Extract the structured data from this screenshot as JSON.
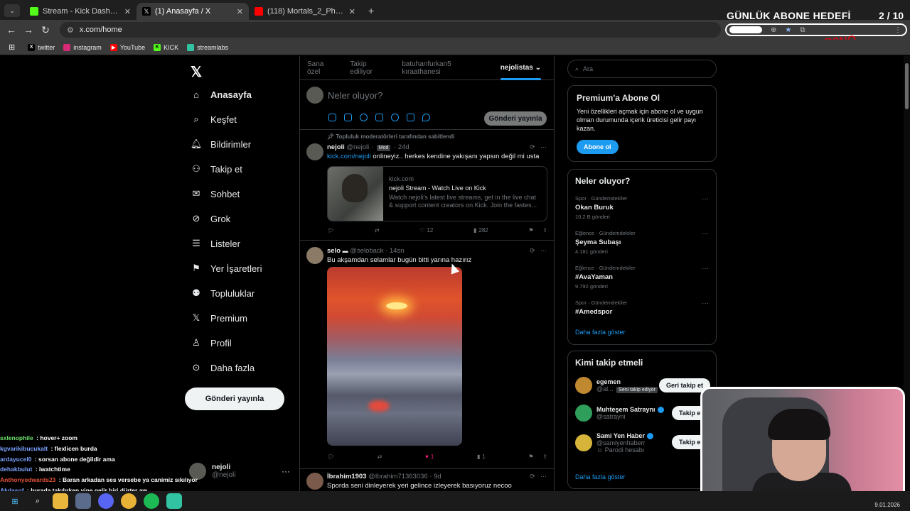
{
  "browser": {
    "tabs": [
      {
        "title": "Stream - Kick Dashboard",
        "favicon_color": "#53fc18",
        "active": false
      },
      {
        "title": "(1) Anasayfa / X",
        "favicon_color": "#000000",
        "active": true
      },
      {
        "title": "(118) Mortals_2_Phut_Hon_Funk",
        "favicon_color": "#ff0000",
        "active": false
      }
    ],
    "url": "x.com/home",
    "bookmarks": [
      "twitter",
      "instagram",
      "YouTube",
      "KICK",
      "streamlabs"
    ]
  },
  "overlay": {
    "goal_title": "GÜNLÜK ABONE HEDEFİ",
    "goal_count": "2 / 10",
    "goal_progress": 0.2,
    "watermark": "B9NO"
  },
  "sidebar": {
    "items": [
      {
        "label": "Anasayfa",
        "icon": "home-icon"
      },
      {
        "label": "Keşfet",
        "icon": "search-icon"
      },
      {
        "label": "Bildirimler",
        "icon": "bell-icon"
      },
      {
        "label": "Takip et",
        "icon": "follow-icon"
      },
      {
        "label": "Sohbet",
        "icon": "mail-icon"
      },
      {
        "label": "Grok",
        "icon": "grok-icon"
      },
      {
        "label": "Listeler",
        "icon": "list-icon"
      },
      {
        "label": "Yer İşaretleri",
        "icon": "bookmark-icon"
      },
      {
        "label": "Topluluklar",
        "icon": "communities-icon"
      },
      {
        "label": "Premium",
        "icon": "x-icon"
      },
      {
        "label": "Profil",
        "icon": "profile-icon"
      },
      {
        "label": "Daha fazla",
        "icon": "more-icon"
      }
    ],
    "post_button": "Gönderi yayınla",
    "account": {
      "name": "nejoli",
      "handle": "@nejoli"
    }
  },
  "feed": {
    "tabs": [
      "Sana özel",
      "Takip ediliyor",
      "batuhanfurkan5 kıraathanesi",
      "nejolistas"
    ],
    "compose": {
      "placeholder": "Neler oluyor?",
      "button": "Gönderi yayınla"
    },
    "tweets": [
      {
        "pinned": "Topluluk moderatörleri tarafından sabitlendi",
        "name": "nejoli",
        "handle": "@nejoli",
        "badge": "Mod",
        "time": "24d",
        "link": "kick.com/nejoli",
        "text": " onlineyiz.. herkes kendine yakışanı yapsın değil mi usta",
        "card": {
          "domain": "kick.com",
          "title": "nejoli Stream - Watch Live on Kick",
          "desc1": "Watch nejoli's latest live streams, get in the live chat",
          "desc2": "& support content creators on Kick. Join the fastes..."
        },
        "likes": "12",
        "views": "282"
      },
      {
        "name": "selo",
        "handle": "@seloback",
        "time": "14sn",
        "text": "Bu akşamdan selamlar bugün bitti yarına hazırız",
        "likes": "1",
        "views": "1"
      },
      {
        "name": "İbrahim1903",
        "handle": "@Ibrahim71363036",
        "time": "9d",
        "text": "Sporda seni dinleyerek yeri gelince izleyerek basıyoruz necoo"
      }
    ]
  },
  "right": {
    "search_placeholder": "Ara",
    "premium": {
      "title": "Premium'a Abone Ol",
      "text": "Yeni özellikleri açmak için abone ol ve uygun olman durumunda içerik üreticisi gelir payı kazan.",
      "button": "Abone ol"
    },
    "trends_title": "Neler oluyor?",
    "trends": [
      {
        "category": "Spor · Gündemdekiler",
        "name": "Okan Buruk",
        "count": "10,2 B gönderi"
      },
      {
        "category": "Eğlence · Gündemdekiler",
        "name": "Şeyma Subaşı",
        "count": "4.181 gönderi"
      },
      {
        "category": "Eğlence · Gündemdekiler",
        "name": "#AvaYaman",
        "count": "9.792 gönderi"
      },
      {
        "category": "Spor · Gündemdekiler",
        "name": "#Amedspor",
        "count": ""
      }
    ],
    "trends_more": "Daha fazla göster",
    "who_title": "Kimi takip etmeli",
    "who": [
      {
        "name": "egemen",
        "handle": "@al...",
        "note": "Seni takip ediyor",
        "button": "Geri takip et"
      },
      {
        "name": "Muhteşem Satraynı",
        "handle": "@satrayni",
        "note": "",
        "button": "Takip et"
      },
      {
        "name": "Sami Yen Haber",
        "handle": "@samiyenhaberr",
        "note": "Parodi hesabı",
        "button": "Takip et"
      }
    ],
    "who_more": "Daha fazla göster"
  },
  "chat": [
    {
      "user": "sxlenophile",
      "msg": "hover+ zoom",
      "color": "#6ee36e"
    },
    {
      "user": "kgvarikibucukalt",
      "msg": "flexlicen burda",
      "color": "#7aa2ff"
    },
    {
      "user": "ardayucel0",
      "msg": "sorsan abone değildir ama",
      "color": "#7aa2ff"
    },
    {
      "user": "dehakbulut",
      "msg": "iwatchtime",
      "color": "#7aa2ff"
    },
    {
      "user": "Anthonyedwards23",
      "msg": "Baran arkadan ses versebe ya canimiz sıkılıyor",
      "color": "#e5533c"
    },
    {
      "user": "Akdasof",
      "msg": "burada takılırken yine gelir biri dürter aw",
      "color": "#7aa2ff"
    }
  ],
  "taskbar": {
    "date": "9.01.2026"
  }
}
